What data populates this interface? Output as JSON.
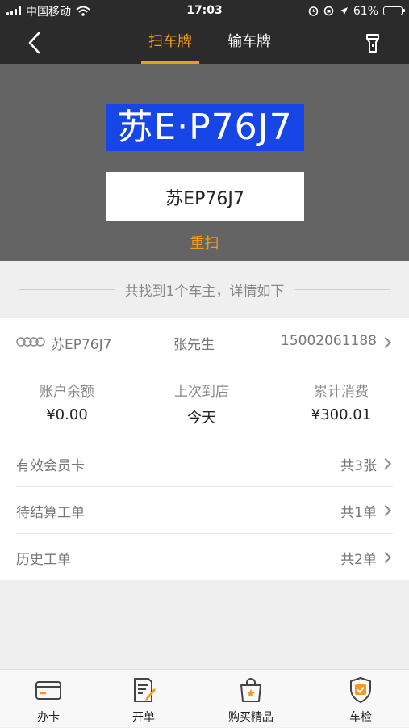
{
  "status": {
    "carrier": "中国移动",
    "time": "17:03",
    "battery": "61%",
    "battery_level": 0.61
  },
  "nav": {
    "tabs": [
      {
        "label": "扫车牌",
        "active": true
      },
      {
        "label": "输车牌",
        "active": false
      }
    ]
  },
  "scan": {
    "plate_text": "苏E·P76J7",
    "recognized": "苏EP76J7",
    "rescan_label": "重扫"
  },
  "result": {
    "summary": "共找到1个车主，详情如下"
  },
  "owner": {
    "plate": "苏EP76J7",
    "name": "张先生",
    "phone": "15002061188"
  },
  "stats": [
    {
      "label": "账户余额",
      "value": "¥0.00"
    },
    {
      "label": "上次到店",
      "value": "今天"
    },
    {
      "label": "累计消费",
      "value": "¥300.01"
    }
  ],
  "items": [
    {
      "label": "有效会员卡",
      "count": "共3张"
    },
    {
      "label": "待结算工单",
      "count": "共1单"
    },
    {
      "label": "历史工单",
      "count": "共2单"
    }
  ],
  "tabbar": [
    {
      "label": "办卡",
      "icon": "card-icon"
    },
    {
      "label": "开单",
      "icon": "order-icon"
    },
    {
      "label": "购买精品",
      "icon": "shopping-bag-icon"
    },
    {
      "label": "车检",
      "icon": "inspection-shield-icon"
    }
  ],
  "colors": {
    "accent": "#f49a1f",
    "dark_bar": "#2b2b2b",
    "scan_bg": "#646464",
    "plate_blue": "#1745e6"
  }
}
